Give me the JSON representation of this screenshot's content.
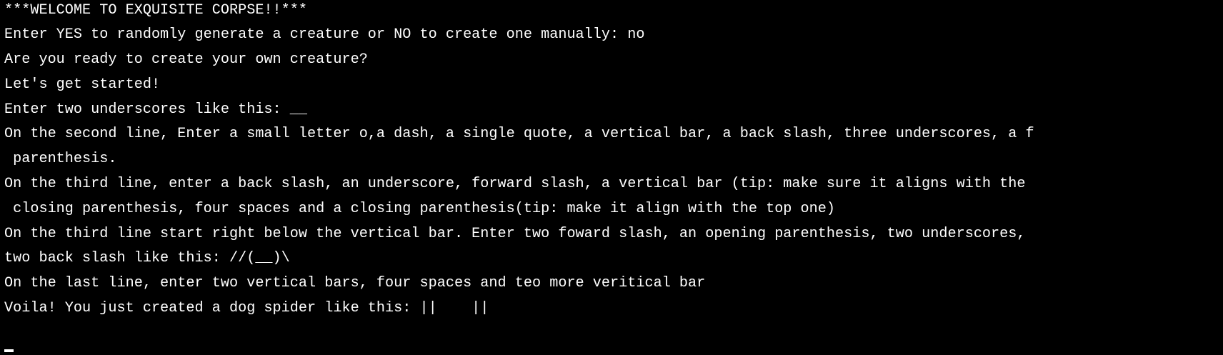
{
  "terminal": {
    "background": "#000000",
    "foreground": "#ffffff",
    "lines": [
      "***WELCOME TO EXQUISITE CORPSE!!***",
      "Enter YES to randomly generate a creature or NO to create one manually: no",
      "Are you ready to create your own creature?",
      "Let's get started!",
      "Enter two underscores like this: __",
      "On the second line, Enter a small letter o,a dash, a single quote, a vertical bar, a back slash, three underscores, a f",
      " parenthesis.",
      "On the third line, enter a back slash, an underscore, forward slash, a vertical bar (tip: make sure it aligns with the",
      " closing parenthesis, four spaces and a closing parenthesis(tip: make it align with the top one)",
      "On the third line start right below the vertical bar. Enter two foward slash, an opening parenthesis, two underscores,",
      "two back slash like this: //(__)\\",
      "On the last line, enter two vertical bars, four spaces and teo more veritical bar",
      "Voila! You just created a dog spider like this: ||    ||"
    ]
  }
}
